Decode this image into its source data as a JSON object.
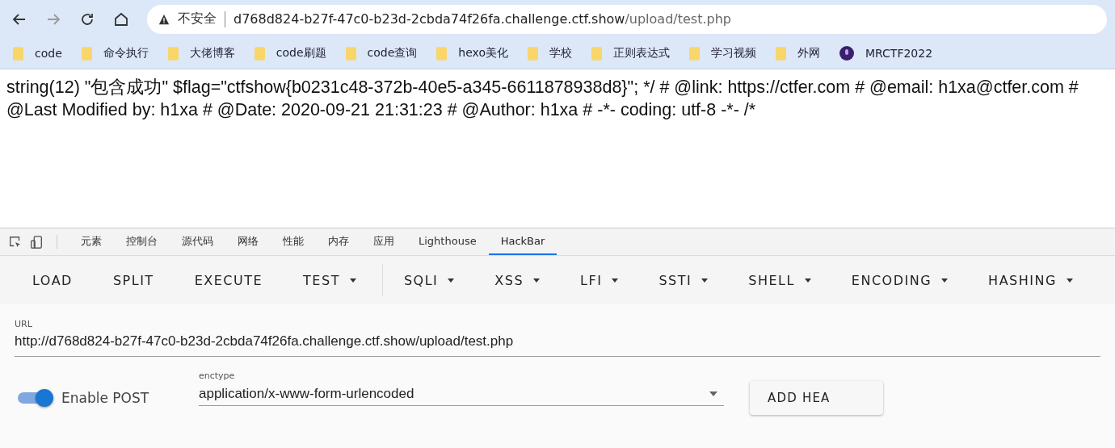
{
  "browser": {
    "security_label": "不安全",
    "url": {
      "host": "d768d824-b27f-47c0-b23d-2cbda74f26fa.challenge.ctf.show",
      "path": "/upload/test.php"
    }
  },
  "bookmarks": [
    {
      "label": "code",
      "kind": "folder"
    },
    {
      "label": "命令执行",
      "kind": "folder"
    },
    {
      "label": "大佬博客",
      "kind": "folder"
    },
    {
      "label": "code刷题",
      "kind": "folder"
    },
    {
      "label": "code查询",
      "kind": "folder"
    },
    {
      "label": "hexo美化",
      "kind": "folder"
    },
    {
      "label": "学校",
      "kind": "folder"
    },
    {
      "label": "正则表达式",
      "kind": "folder"
    },
    {
      "label": "学习视频",
      "kind": "folder"
    },
    {
      "label": "外网",
      "kind": "folder"
    },
    {
      "label": "MRCTF2022",
      "kind": "site"
    }
  ],
  "page_text": "string(12) \"包含成功\" $flag=\"ctfshow{b0231c48-372b-40e5-a345-6611878938d8}\"; */ # @link: https://ctfer.com # @email: h1xa@ctfer.com # @Last Modified by: h1xa # @Date: 2020-09-21 21:31:23 # @Author: h1xa # -*- coding: utf-8 -*- /*",
  "devtools_tabs": [
    {
      "label": "元素",
      "selected": false
    },
    {
      "label": "控制台",
      "selected": false
    },
    {
      "label": "源代码",
      "selected": false
    },
    {
      "label": "网络",
      "selected": false
    },
    {
      "label": "性能",
      "selected": false
    },
    {
      "label": "内存",
      "selected": false
    },
    {
      "label": "应用",
      "selected": false
    },
    {
      "label": "Lighthouse",
      "selected": false
    },
    {
      "label": "HackBar",
      "selected": true
    }
  ],
  "hackbar_menu": [
    {
      "label": "LOAD",
      "kind": "button"
    },
    {
      "label": "SPLIT",
      "kind": "button"
    },
    {
      "label": "EXECUTE",
      "kind": "button"
    },
    {
      "label": "TEST",
      "kind": "dropdown"
    },
    {
      "label": "SQLI",
      "kind": "dropdown"
    },
    {
      "label": "XSS",
      "kind": "dropdown"
    },
    {
      "label": "LFI",
      "kind": "dropdown"
    },
    {
      "label": "SSTI",
      "kind": "dropdown"
    },
    {
      "label": "SHELL",
      "kind": "dropdown"
    },
    {
      "label": "ENCODING",
      "kind": "dropdown"
    },
    {
      "label": "HASHING",
      "kind": "dropdown"
    }
  ],
  "url_field": {
    "label": "URL",
    "value": "http://d768d824-b27f-47c0-b23d-2cbda74f26fa.challenge.ctf.show/upload/test.php"
  },
  "enable_post": {
    "label": "Enable POST",
    "on": true
  },
  "enctype": {
    "label": "enctype",
    "value": "application/x-www-form-urlencoded"
  },
  "add_headers_button": "ADD HEA"
}
